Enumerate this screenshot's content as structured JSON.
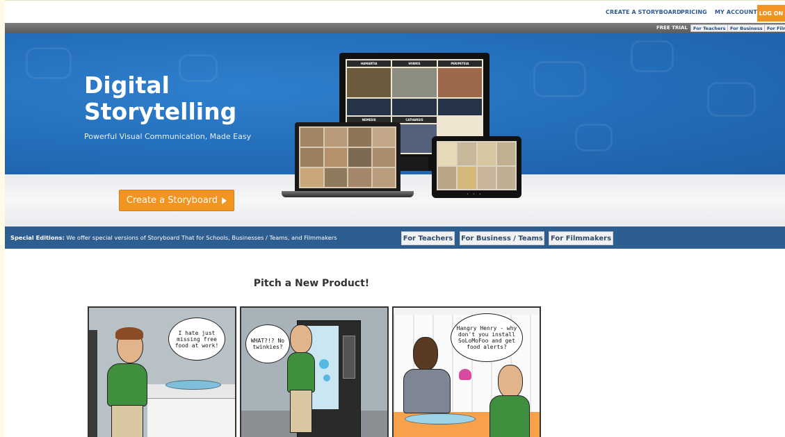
{
  "nav": {
    "create": "CREATE A STORYBOARD",
    "pricing": "PRICING",
    "account": "MY ACCOUNT",
    "logon": "LOG ON"
  },
  "trial": {
    "label": "FREE TRIAL",
    "teachers": "For Teachers",
    "business": "For Business",
    "film": "For Film"
  },
  "hero": {
    "title_line1": "Digital",
    "title_line2": "Storytelling",
    "subtitle": "Powerful Visual Communication, Made Easy",
    "cta": "Create a Storyboard",
    "monitor_headers": [
      "HAMARTIA",
      "HUBRIS",
      "PERIPETEIA"
    ],
    "monitor_headers_2": [
      "NEMESIS",
      "CATHARSIS"
    ]
  },
  "editions": {
    "label_bold": "Special Editions:",
    "label_rest": " We offer special versions of Storyboard That for Schools, Businesses / Teams, and Filmmakers",
    "buttons": [
      "For Teachers",
      "For Business / Teams",
      "For Filmmakers"
    ]
  },
  "content": {
    "heading": "Pitch a New Product!",
    "bubble1": "I hate just missing free food at work!",
    "bubble2": "WHAT?!? No twinkies?",
    "bubble3": "Hangry Henry - why don't you install SoLoMoFoo and get food alerts?"
  },
  "colors": {
    "brand_blue": "#236db8",
    "orange": "#f29420",
    "nav_blue": "#2f5a91",
    "editions_bar": "#2e5d8f"
  }
}
